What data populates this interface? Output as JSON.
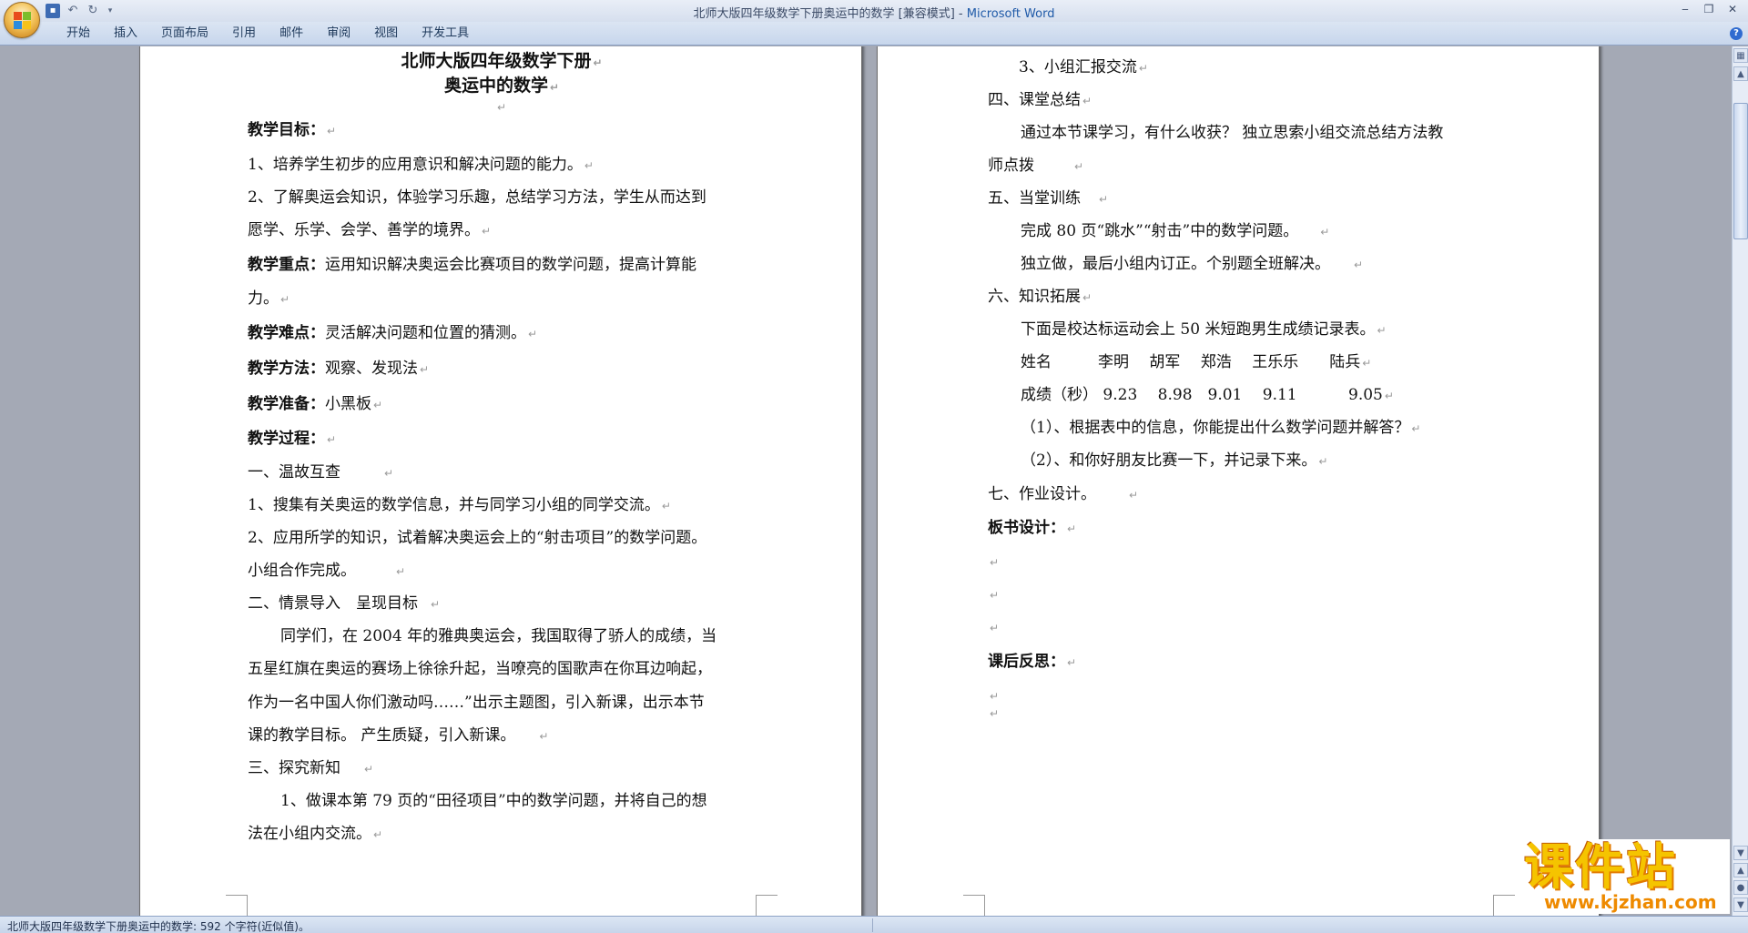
{
  "window": {
    "title_doc": "北师大版四年级数学下册奥运中的数学 [兼容模式]",
    "title_sep": " - ",
    "title_app": "Microsoft Word"
  },
  "ribbon": {
    "tabs": [
      "开始",
      "插入",
      "页面布局",
      "引用",
      "邮件",
      "审阅",
      "视图",
      "开发工具"
    ]
  },
  "page1": {
    "title1": "北师大版四年级数学下册",
    "title2": "奥运中的数学",
    "goal_h": "教学目标：",
    "goal1": "1、培养学生初步的应用意识和解决问题的能力。",
    "goal2a": "2、了解奥运会知识，体验学习乐趣，总结学习方法，学生从而达到",
    "goal2b": "愿学、乐学、会学、善学的境界。",
    "key_h": "教学重点：",
    "key_a": "运用知识解决奥运会比赛项目的数学问题，提高计算能",
    "key_b": "力。",
    "diff_h": "教学难点：",
    "diff_t": "灵活解决问题和位置的猜测。",
    "method_h": "教学方法：",
    "method_t": "观察、发现法",
    "prep_h": "教学准备：",
    "prep_t": "小黑板",
    "proc_h": "教学过程：",
    "s1": "一、温故互查",
    "s1_1": "1、搜集有关奥运的数学信息，并与同学习小组的同学交流。",
    "s1_2a": "2、应用所学的知识，试着解决奥运会上的“射击项目”的数学问题。",
    "s1_2b": "小组合作完成。",
    "s2": "二、情景导入　呈现目标",
    "p2a": "同学们，在 2004 年的雅典奥运会，我国取得了骄人的成绩，当",
    "p2b": "五星红旗在奥运的赛场上徐徐升起，当嘹亮的国歌声在你耳边响起，",
    "p2c": "作为一名中国人你们激动吗……”出示主题图，引入新课，出示本节",
    "p2d": "课的教学目标。 产生质疑，引入新课。",
    "s3": "三、探究新知",
    "s3_1a": "1、做课本第 79 页的“田径项目”中的数学问题，并将自己的想",
    "s3_1b": "法在小组内交流。"
  },
  "page2": {
    "l1": "3、小组汇报交流",
    "s4": "四、课堂总结",
    "l4a": "通过本节课学习，有什么收获？ 独立思索小组交流总结方法教",
    "l4b": "师点拨",
    "s5": "五、当堂训练",
    "l5a": "完成 80 页“跳水”“射击”中的数学问题。",
    "l5b": "独立做，最后小组内订正。个别题全班解决。",
    "s6": "六、知识拓展",
    "l6a": "下面是校达标运动会上 50 米短跑男生成绩记录表。",
    "l6_names": "姓名　　　李明　 胡军　 郑浩　 王乐乐　　陆兵",
    "l6_scores": "成绩（秒） 9.23　  8.98　9.01　  9.11　　　  9.05",
    "l6c": "（1）、根据表中的信息，你能提出什么数学问题并解答？",
    "l6d": "（2）、和你好朋友比赛一下，并记录下来。",
    "s7": "七、作业设计。",
    "board_h": "板书设计：",
    "reflect_h": "课后反思："
  },
  "status": {
    "text": "北师大版四年级数学下册奥运中的数学: 592 个字符(近似值)。"
  },
  "watermark": {
    "big": "课件站",
    "url": "www.kjzhan.com"
  },
  "marks": {
    "para": "↵"
  },
  "colors": {
    "workspace": "#a4a9b5",
    "ribbon": "#c7d6ec",
    "watermark_yellow": "#f5c400",
    "watermark_orange": "#ee8a00"
  }
}
